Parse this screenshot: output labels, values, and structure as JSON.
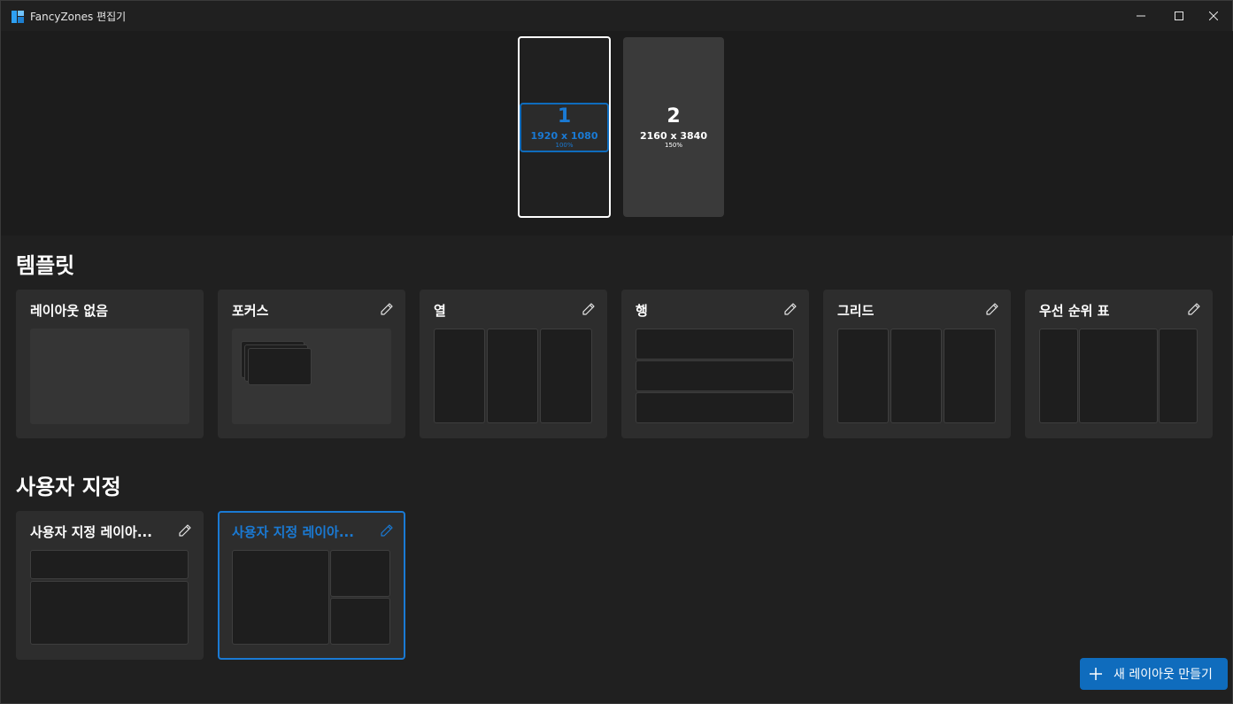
{
  "window": {
    "title": "FancyZones 편집기"
  },
  "monitors": [
    {
      "number": "1",
      "resolution": "1920 x 1080",
      "scale": "100%",
      "selected": true
    },
    {
      "number": "2",
      "resolution": "2160 x 3840",
      "scale": "150%",
      "selected": false
    }
  ],
  "templates": {
    "title": "템플릿",
    "items": [
      {
        "label": "레이아웃 없음",
        "editable": false
      },
      {
        "label": "포커스",
        "editable": true
      },
      {
        "label": "열",
        "editable": true
      },
      {
        "label": "행",
        "editable": true
      },
      {
        "label": "그리드",
        "editable": true
      },
      {
        "label": "우선 순위 표",
        "editable": true
      }
    ]
  },
  "custom": {
    "title": "사용자 지정",
    "items": [
      {
        "label": "사용자 지정 레이아...",
        "editable": true,
        "selected": false
      },
      {
        "label": "사용자 지정 레이아...",
        "editable": true,
        "selected": true
      }
    ]
  },
  "actions": {
    "new_layout_label": "새 레이아웃 만들기"
  },
  "colors": {
    "accent": "#0f6cbd",
    "accent_text": "#1a7ad4",
    "background": "#202020",
    "card": "#2d2d2d"
  },
  "icons": {
    "edit": "pencil-icon",
    "add": "plus-icon",
    "minimize": "minimize-icon",
    "maximize": "maximize-icon",
    "close": "close-icon"
  }
}
